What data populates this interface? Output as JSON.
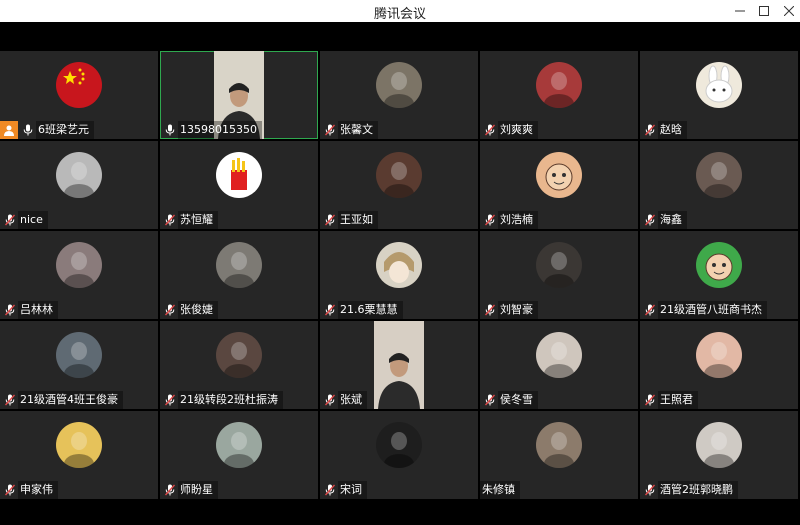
{
  "window": {
    "title": "腾讯会议",
    "minimize_glyph": "—",
    "maximize_glyph": "☐",
    "close_glyph": "✕"
  },
  "colors": {
    "tile_bg": "#262626",
    "active_border": "#2fa84f",
    "host_badge": "#f08a24",
    "muted_icon": "#e04848"
  },
  "participants": [
    {
      "name": "6班梁艺元",
      "mic": "on",
      "host": true,
      "avatar": "china-flag-avatar",
      "bg": "#c8161d"
    },
    {
      "name": "13598015350",
      "mic": "on",
      "video": true,
      "active": true,
      "avatar": "man-video",
      "bg": "#d9d4c8"
    },
    {
      "name": "张馨文",
      "mic": "muted",
      "avatar": "photo-avatar",
      "bg": "#7c7466"
    },
    {
      "name": "刘爽爽",
      "mic": "muted",
      "avatar": "photo-avatar",
      "bg": "#a73a3a"
    },
    {
      "name": "赵晗",
      "mic": "muted",
      "avatar": "bunny-avatar",
      "bg": "#efe9dc"
    },
    {
      "name": "nice",
      "mic": "muted",
      "avatar": "photo-avatar",
      "bg": "#b9b9b9"
    },
    {
      "name": "苏恒耀",
      "mic": "muted",
      "avatar": "fries-avatar",
      "bg": "#ffffff"
    },
    {
      "name": "王亚如",
      "mic": "muted",
      "avatar": "photo-avatar",
      "bg": "#5a3b30"
    },
    {
      "name": "刘浩楠",
      "mic": "muted",
      "avatar": "cartoon-avatar",
      "bg": "#e9b78e"
    },
    {
      "name": "海鑫",
      "mic": "muted",
      "avatar": "photo-avatar",
      "bg": "#6a5a52"
    },
    {
      "name": "吕林林",
      "mic": "muted",
      "avatar": "photo-avatar",
      "bg": "#8a7b7b"
    },
    {
      "name": "张俊婕",
      "mic": "muted",
      "avatar": "photo-avatar",
      "bg": "#7d7a74"
    },
    {
      "name": "21.6栗慧慧",
      "mic": "muted",
      "avatar": "anime-avatar",
      "bg": "#d8d2c4"
    },
    {
      "name": "刘智豪",
      "mic": "muted",
      "avatar": "photo-avatar",
      "bg": "#3b3734"
    },
    {
      "name": "21级酒管八班商书杰",
      "mic": "muted",
      "avatar": "cartoon-avatar",
      "bg": "#3fa94a"
    },
    {
      "name": "21级酒管4班王俊豪",
      "mic": "muted",
      "avatar": "photo-avatar",
      "bg": "#5f6a73"
    },
    {
      "name": "21级转段2班杜振涛",
      "mic": "muted",
      "avatar": "photo-avatar",
      "bg": "#5a4740"
    },
    {
      "name": "张斌",
      "mic": "muted",
      "video": true,
      "avatar": "man-video",
      "bg": "#d7cfc4"
    },
    {
      "name": "侯冬雪",
      "mic": "muted",
      "avatar": "photo-avatar",
      "bg": "#cfc6bd"
    },
    {
      "name": "王照君",
      "mic": "muted",
      "avatar": "photo-avatar",
      "bg": "#e2b8a5"
    },
    {
      "name": "申家伟",
      "mic": "muted",
      "avatar": "photo-avatar",
      "bg": "#e6c25a"
    },
    {
      "name": "师盼星",
      "mic": "muted",
      "avatar": "photo-avatar",
      "bg": "#9aa79f"
    },
    {
      "name": "宋词",
      "mic": "muted",
      "avatar": "photo-avatar",
      "bg": "#1e1e1e"
    },
    {
      "name": "朱修镇",
      "mic": "none",
      "avatar": "photo-avatar",
      "bg": "#8c7b6b"
    },
    {
      "name": "酒管2班郭晓鹏",
      "mic": "muted",
      "avatar": "photo-avatar",
      "bg": "#cfcac4"
    }
  ]
}
